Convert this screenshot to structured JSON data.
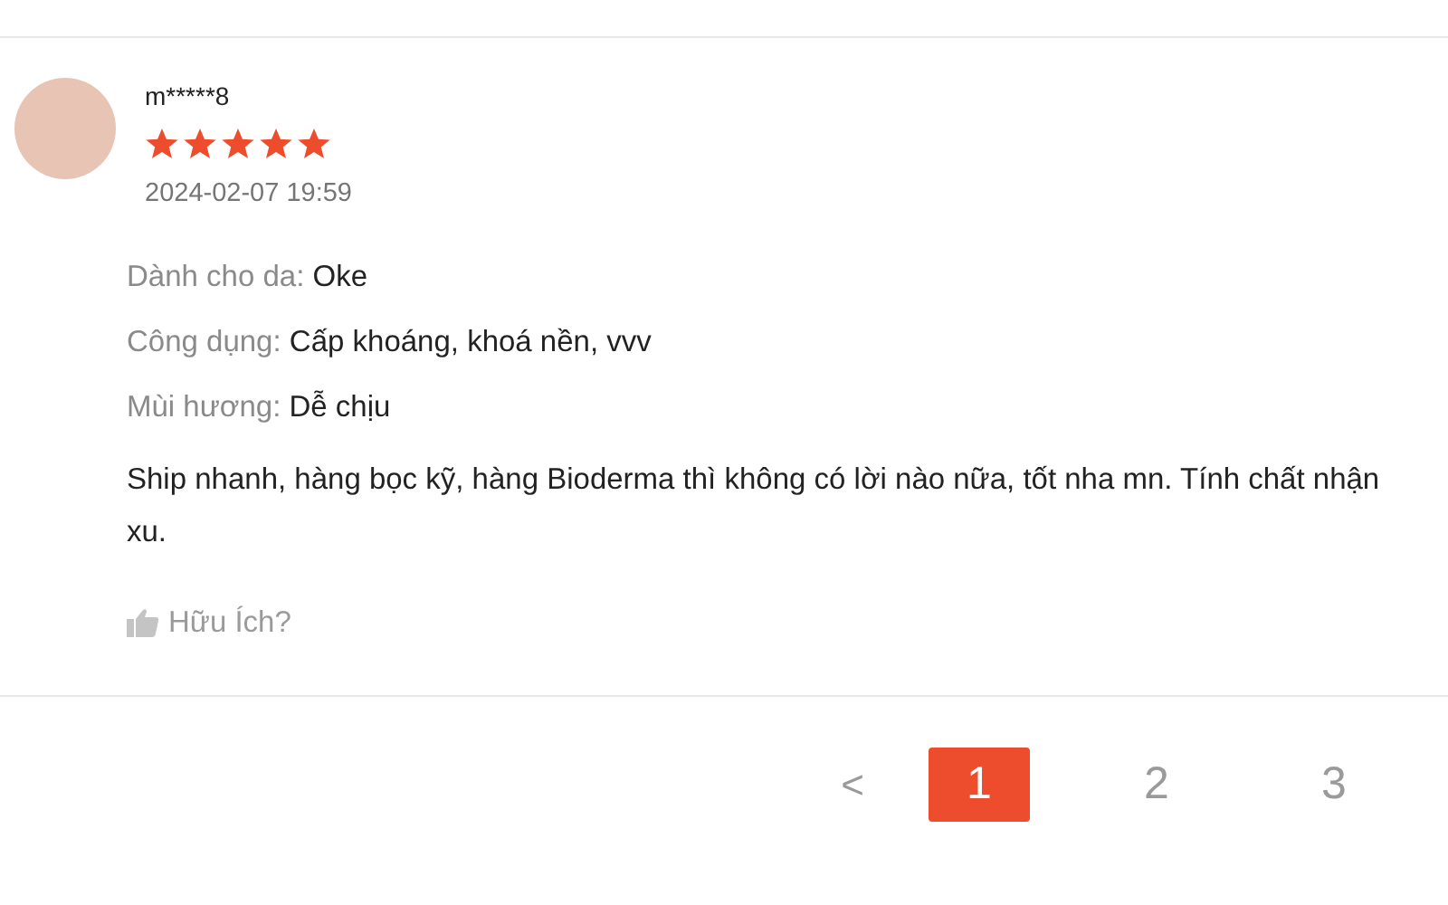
{
  "review": {
    "username": "m*****8",
    "stars": 5,
    "date": "2024-02-07 19:59",
    "attributes": [
      {
        "label": "Dành cho da:",
        "value": "Oke"
      },
      {
        "label": "Công dụng:",
        "value": "Cấp khoáng, khoá nền, vvv"
      },
      {
        "label": "Mùi hương:",
        "value": "Dễ chịu"
      }
    ],
    "text": "Ship nhanh, hàng bọc kỹ, hàng Bioderma thì không có lời nào nữa, tốt nha mn. Tính chất nhận xu.",
    "helpful": "Hữu Ích?"
  },
  "pagination": {
    "prev": "<",
    "pages": [
      {
        "label": "1",
        "selected": true
      },
      {
        "label": "2",
        "selected": false
      },
      {
        "label": "3",
        "selected": false
      }
    ]
  }
}
